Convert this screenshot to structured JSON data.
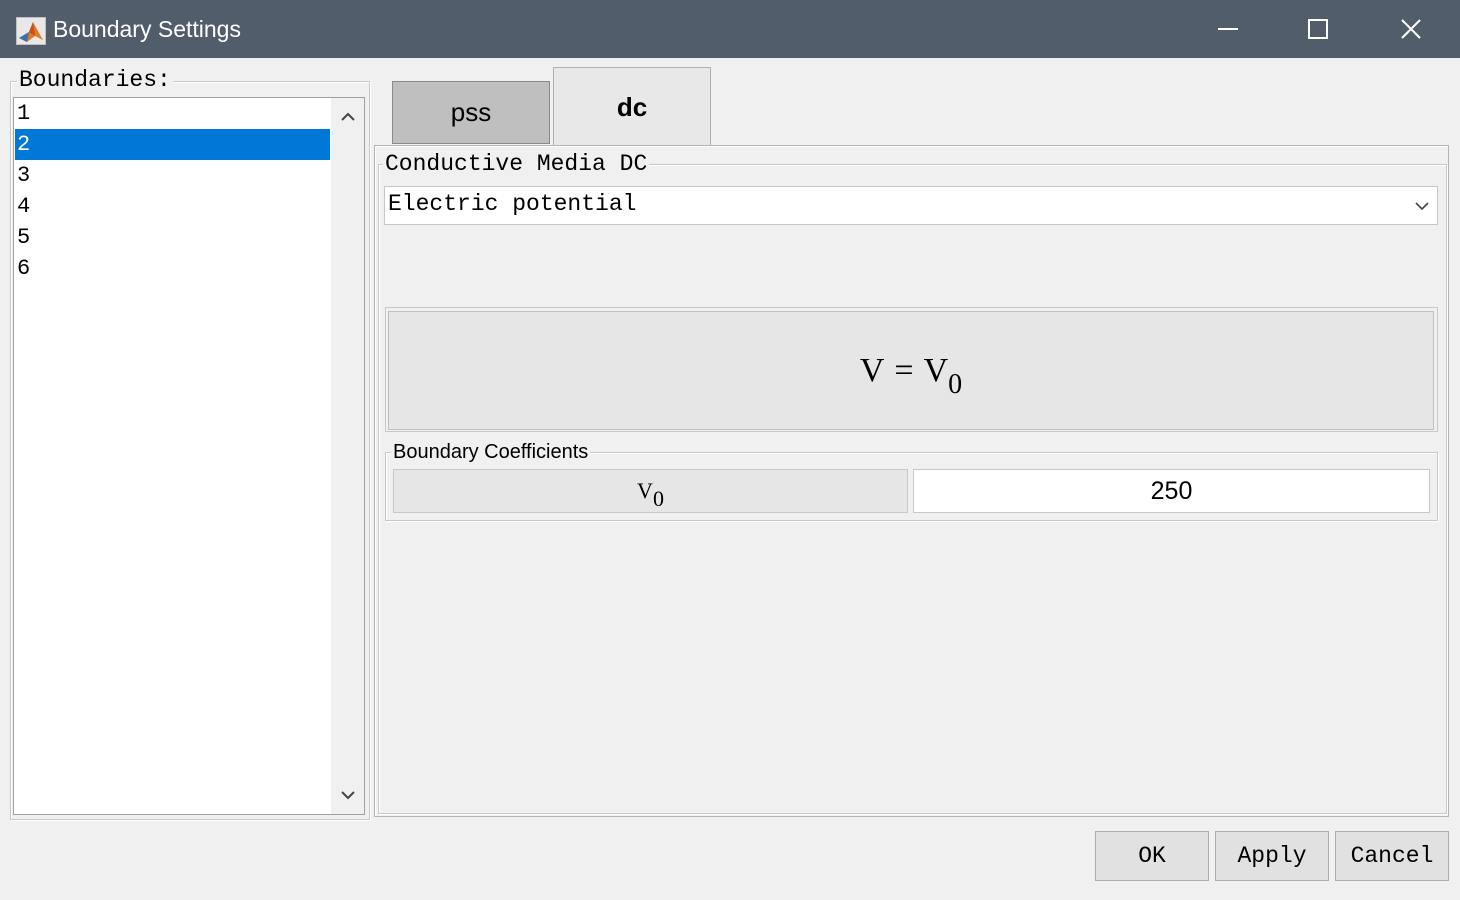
{
  "window": {
    "title": "Boundary Settings",
    "controls": [
      "minimize-icon",
      "maximize-icon",
      "close-icon"
    ]
  },
  "boundaries": {
    "label": "Boundaries:",
    "items": [
      "1",
      "2",
      "3",
      "4",
      "5",
      "6"
    ],
    "selected": "2"
  },
  "tabs": [
    {
      "label": "pss",
      "active": false
    },
    {
      "label": "dc",
      "active": true
    }
  ],
  "panel": {
    "group_title": "Conductive Media DC",
    "condition_value": "Electric potential",
    "equation": {
      "lhs": "V",
      "op": "=",
      "rhs": "V",
      "rhs_sub": "0"
    },
    "coefficients": {
      "title": "Boundary Coefficients",
      "label": "V",
      "label_sub": "0",
      "value": "250"
    }
  },
  "buttons": {
    "ok": "OK",
    "apply": "Apply",
    "cancel": "Cancel"
  },
  "colors": {
    "titlebar": "#515d6b",
    "selection": "#0078d7",
    "background": "#f0f0f0"
  }
}
